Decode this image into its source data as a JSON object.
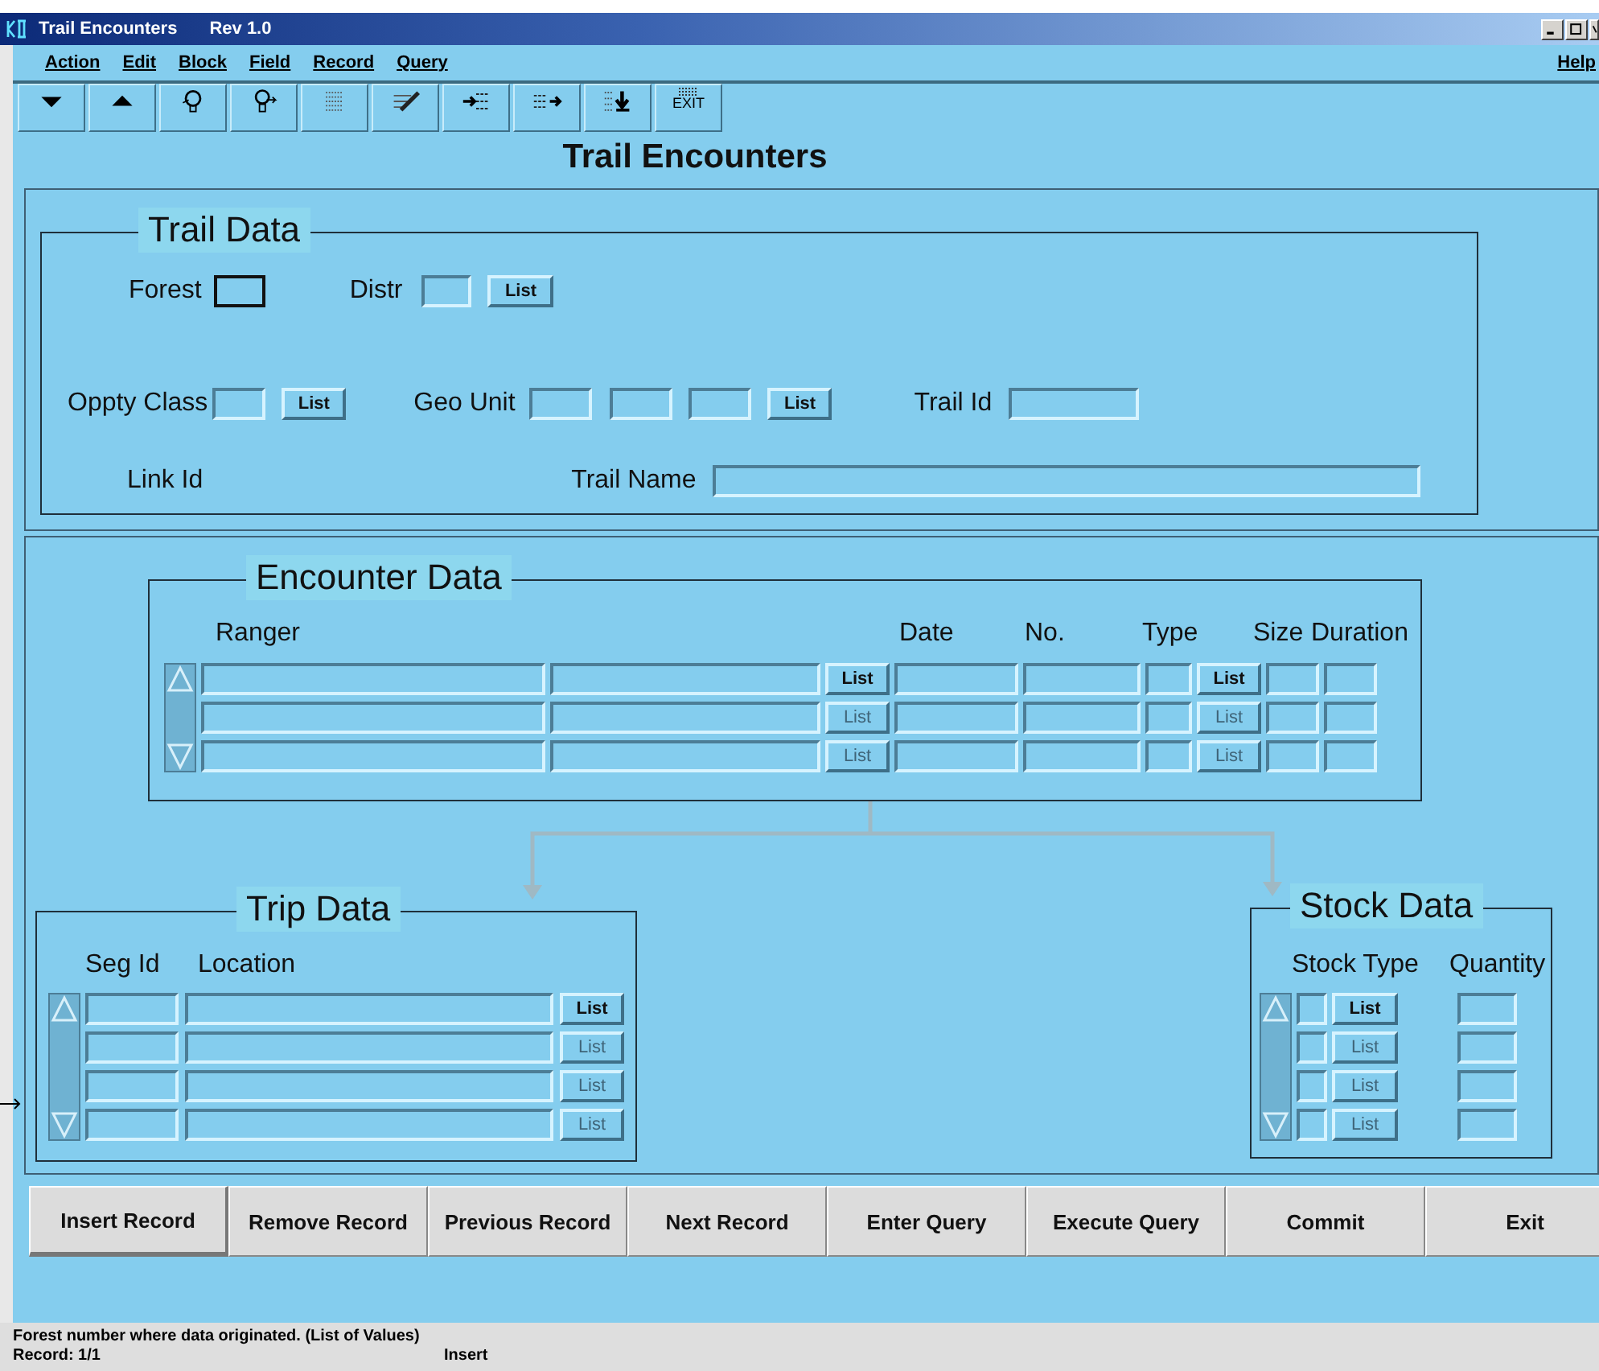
{
  "window": {
    "title": "Trail Encounters",
    "revision": "Rev 1.0"
  },
  "menu": [
    {
      "label": "Action"
    },
    {
      "label": "Edit"
    },
    {
      "label": "Block"
    },
    {
      "label": "Field"
    },
    {
      "label": "Record"
    },
    {
      "label": "Query"
    }
  ],
  "help_menu": {
    "label": "Help"
  },
  "toolbar": [
    {
      "kind": "down"
    },
    {
      "kind": "up"
    },
    {
      "kind": "bulb"
    },
    {
      "kind": "bulb-arrow"
    },
    {
      "kind": "lines"
    },
    {
      "kind": "pen"
    },
    {
      "kind": "arrow-in"
    },
    {
      "kind": "arrow-out"
    },
    {
      "kind": "download"
    },
    {
      "kind": "exit",
      "label": "EXIT"
    }
  ],
  "form_title": "Trail Encounters",
  "trail_data": {
    "title": "Trail Data",
    "forest": {
      "label": "Forest",
      "focused": true
    },
    "district": {
      "label": "Distr",
      "focused": false,
      "list": "List"
    },
    "oppty_class": {
      "label": "Oppty Class",
      "focused": false,
      "list": "List"
    },
    "geo_unit": {
      "label": "Geo Unit",
      "focused": false,
      "list": "List"
    },
    "trail_id": {
      "label": "Trail Id",
      "focused": false
    },
    "link_id": {
      "label": "Link Id"
    },
    "trail_name": {
      "label": "Trail Name",
      "focused": false
    }
  },
  "encounter_data": {
    "title": "Encounter Data",
    "columns": [
      "Ranger",
      "Date",
      "No.",
      "Type",
      "Size",
      "Duration"
    ],
    "rows": [
      {
        "list_enabled": true,
        "ranger_list": "List",
        "type_list": "List"
      },
      {
        "list_enabled": false,
        "ranger_list": "List",
        "type_list": "List"
      },
      {
        "list_enabled": false,
        "ranger_list": "List",
        "type_list": "List"
      }
    ]
  },
  "trip_data": {
    "title": "Trip Data",
    "columns": [
      "Seg Id",
      "Location"
    ],
    "rows": [
      {
        "list_enabled": true,
        "list": "List"
      },
      {
        "list_enabled": false,
        "list": "List"
      },
      {
        "list_enabled": false,
        "list": "List"
      },
      {
        "list_enabled": false,
        "list": "List"
      }
    ]
  },
  "stock_data": {
    "title": "Stock Data",
    "columns": [
      "Stock Type",
      "Quantity"
    ],
    "rows": [
      {
        "list_enabled": true,
        "list": "List"
      },
      {
        "list_enabled": false,
        "list": "List"
      },
      {
        "list_enabled": false,
        "list": "List"
      },
      {
        "list_enabled": false,
        "list": "List"
      }
    ]
  },
  "buttons": [
    {
      "label": "Insert Record",
      "default": true
    },
    {
      "label": "Remove Record",
      "default": false
    },
    {
      "label": "Previous Record",
      "default": false
    },
    {
      "label": "Next Record",
      "default": false
    },
    {
      "label": "Enter Query",
      "default": false
    },
    {
      "label": "Execute Query",
      "default": false
    },
    {
      "label": "Commit",
      "default": false
    },
    {
      "label": "Exit",
      "default": false
    }
  ],
  "status_bar": {
    "message": "Forest number where data originated.  (List of Values)",
    "record": "Record: 1/1",
    "mode": "Insert"
  }
}
